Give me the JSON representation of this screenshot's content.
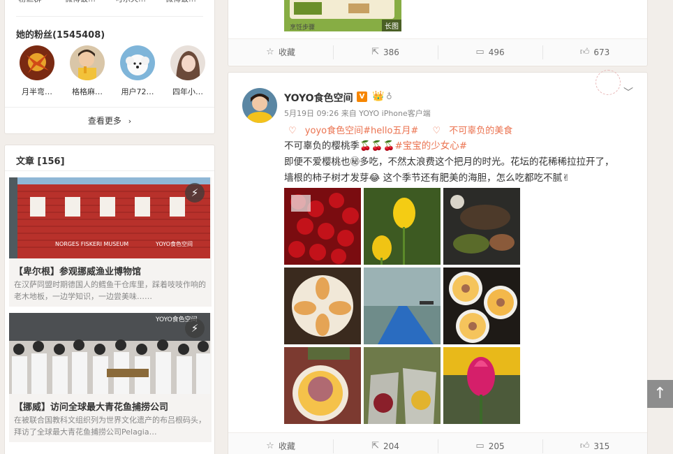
{
  "left": {
    "top_row_names": [
      "粉丝群",
      "微博饭…",
      "可乐天…",
      "微博饭…"
    ],
    "fans_title": "她的粉丝(1545408)",
    "fans": [
      {
        "name": "月半弯…"
      },
      {
        "name": "格格麻…"
      },
      {
        "name": "用户72…"
      },
      {
        "name": "四年小…"
      }
    ],
    "see_more": "查看更多",
    "articles_title": "文章 [156]",
    "articles": [
      {
        "title": "【卑尔根】参观挪威渔业博物馆",
        "desc": "在汉萨同盟时期德国人的鳕鱼干仓库里，踩着吱吱作响的老木地板，一边学知识，一边尝美味……",
        "img_text": "NORGES FISKERI MUSEUM",
        "watermark": "YOYO食色空间"
      },
      {
        "title": "【挪威】访问全球最大青花鱼捕捞公司",
        "desc": "在被联合国教科文组织列为世界文化遗产的布吕根码头，拜访了全球最大青花鱼捕捞公司Pelagia…",
        "watermark": "YOYO食色空间"
      }
    ]
  },
  "prev_post": {
    "image_tag": "长图",
    "caption": "烹饪步骤",
    "actions": {
      "favorite": "收藏",
      "repost": "386",
      "comment": "496",
      "like": "673"
    }
  },
  "post": {
    "author": "YOYO食色空间",
    "vip": "V",
    "meta": "5月19日 09:26 来自 YOYO iPhone客户端",
    "tags": [
      "yoyo食色空间#hello五月#",
      "不可辜负的美食"
    ],
    "line1": "不可辜负的樱桃季🍒🍒🍒",
    "line1_tag": "#宝宝的少女心#",
    "line2": "即便不爱樱桃也㊙多吃，不然太浪费这个把月的时光。花坛的花稀稀拉拉开了，",
    "line3": "墙根的柿子树才发芽😂 这个季节还有肥美的海胆，怎么吃都吃不腻✌",
    "actions": {
      "favorite": "收藏",
      "repost": "204",
      "comment": "205",
      "like": "315"
    }
  },
  "icons": {
    "favorite": "star-icon",
    "repost": "share-icon",
    "comment": "comment-icon",
    "like": "thumbs-up-icon",
    "back_to_top": "arrow-up-icon"
  },
  "colors": {
    "accent": "#eb7350",
    "vip": "#f68600"
  }
}
